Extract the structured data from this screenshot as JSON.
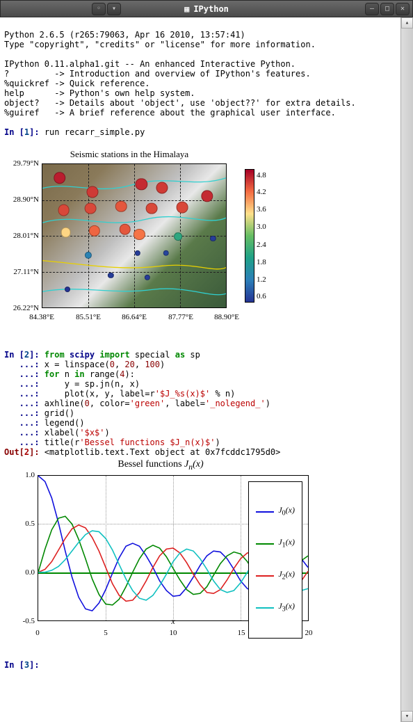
{
  "window": {
    "title": "IPython"
  },
  "intro": {
    "l1": "Python 2.6.5 (r265:79063, Apr 16 2010, 13:57:41)",
    "l2": "Type \"copyright\", \"credits\" or \"license\" for more information.",
    "l3": "IPython 0.11.alpha1.git -- An enhanced Interactive Python.",
    "l4": "?         -> Introduction and overview of IPython's features.",
    "l5": "%quickref -> Quick reference.",
    "l6": "help      -> Python's own help system.",
    "l7": "object?   -> Details about 'object', use 'object??' for extra details.",
    "l8": "%guiref   -> A brief reference about the graphical user interface."
  },
  "prompts": {
    "in": "In [",
    "close": "]: ",
    "cont": "   ...: ",
    "out": "Out[",
    "n1": "1",
    "n2": "2",
    "n3": "3"
  },
  "cell1": {
    "code": "run recarr_simple.py"
  },
  "cell2": {
    "kw_from": "from",
    "mod": "scipy",
    "kw_import": "import",
    "sub": "special",
    "kw_as": "as",
    "alias": "sp",
    "l2a": "x = linspace(",
    "l2b": "0",
    "l2c": ", ",
    "l2d": "20",
    "l2e": ", ",
    "l2f": "100",
    "l2g": ")",
    "kw_for": "for",
    "l3a": " n ",
    "kw_in": "in",
    "l3b": " range(",
    "l3c": "4",
    "l3d": "):",
    "l4": "    y = sp.jn(n, x)",
    "l5a": "    plot(x, y, label=r",
    "l5b": "'$J_%s(x)$'",
    "l5c": " % n)",
    "l6a": "axhline(",
    "l6b": "0",
    "l6c": ", color=",
    "l6d": "'green'",
    "l6e": ", label=",
    "l6f": "'_nolegend_'",
    "l6g": ")",
    "l7": "grid()",
    "l8": "legend()",
    "l9a": "xlabel(",
    "l9b": "'$x$'",
    "l9c": ")",
    "l10a": "title(r",
    "l10b": "'Bessel functions $J_n(x)$'",
    "l10c": ")",
    "out": "<matplotlib.text.Text object at 0x7fcddc1795d0>"
  },
  "chart_data": [
    {
      "type": "scatter",
      "title": "Seismic stations in the Himalaya",
      "xlabel": "",
      "ylabel": "",
      "xticks": [
        "84.38°E",
        "85.51°E",
        "86.64°E",
        "87.77°E",
        "88.90°E"
      ],
      "yticks": [
        "26.22°N",
        "27.11°N",
        "28.01°N",
        "28.90°N",
        "29.79°N"
      ],
      "xlim": [
        84.38,
        88.9
      ],
      "ylim": [
        26.22,
        29.79
      ],
      "colorbar_ticks": [
        "4.8",
        "4.2",
        "3.6",
        "3.0",
        "2.4",
        "1.8",
        "1.2",
        "0.6"
      ],
      "points": [
        {
          "lon": 84.8,
          "lat": 29.45,
          "v": 4.6
        },
        {
          "lon": 85.6,
          "lat": 29.1,
          "v": 4.4
        },
        {
          "lon": 86.8,
          "lat": 29.3,
          "v": 4.5
        },
        {
          "lon": 87.3,
          "lat": 29.2,
          "v": 4.4
        },
        {
          "lon": 88.4,
          "lat": 29.0,
          "v": 4.5
        },
        {
          "lon": 84.9,
          "lat": 28.65,
          "v": 4.3
        },
        {
          "lon": 85.55,
          "lat": 28.7,
          "v": 4.3
        },
        {
          "lon": 86.3,
          "lat": 28.75,
          "v": 4.2
        },
        {
          "lon": 87.05,
          "lat": 28.7,
          "v": 4.3
        },
        {
          "lon": 87.8,
          "lat": 28.73,
          "v": 4.3
        },
        {
          "lon": 84.95,
          "lat": 28.1,
          "v": 3.4
        },
        {
          "lon": 85.65,
          "lat": 28.15,
          "v": 4.1
        },
        {
          "lon": 86.4,
          "lat": 28.18,
          "v": 4.2
        },
        {
          "lon": 86.75,
          "lat": 28.05,
          "v": 4.0
        },
        {
          "lon": 87.7,
          "lat": 28.0,
          "v": 2.2
        },
        {
          "lon": 88.55,
          "lat": 27.95,
          "v": 0.7
        },
        {
          "lon": 85.5,
          "lat": 27.55,
          "v": 1.5
        },
        {
          "lon": 86.7,
          "lat": 27.6,
          "v": 0.7
        },
        {
          "lon": 87.4,
          "lat": 27.6,
          "v": 0.8
        },
        {
          "lon": 86.05,
          "lat": 27.05,
          "v": 0.7
        },
        {
          "lon": 86.95,
          "lat": 27.0,
          "v": 0.7
        },
        {
          "lon": 85.0,
          "lat": 26.7,
          "v": 0.6
        }
      ],
      "color_range": [
        0.6,
        4.8
      ]
    },
    {
      "type": "line",
      "title_prefix": "Bessel functions ",
      "title_math_j": "J",
      "title_math_sub": "n",
      "title_math_x": "(x)",
      "xlabel": "x",
      "ylabel": "",
      "xticks": [
        "0",
        "5",
        "10",
        "15",
        "20"
      ],
      "yticks": [
        "-0.5",
        "0.0",
        "0.5",
        "1.0"
      ],
      "xlim": [
        0,
        20
      ],
      "ylim": [
        -0.5,
        1.0
      ],
      "legend": [
        "J₀(x)",
        "J₁(x)",
        "J₂(x)",
        "J₃(x)"
      ],
      "legend_prefix": "J",
      "legend_sub": [
        "0",
        "1",
        "2",
        "3"
      ],
      "legend_suffix": "(x)",
      "colors": [
        "#1010dd",
        "#008800",
        "#dd2020",
        "#10c0c0"
      ],
      "series": [
        {
          "name": "J0",
          "values": [
            1.0,
            0.94,
            0.77,
            0.51,
            0.22,
            -0.05,
            -0.26,
            -0.38,
            -0.4,
            -0.32,
            -0.18,
            -0.01,
            0.15,
            0.27,
            0.3,
            0.27,
            0.17,
            0.05,
            -0.09,
            -0.19,
            -0.25,
            -0.24,
            -0.16,
            -0.05,
            0.07,
            0.17,
            0.22,
            0.21,
            0.14,
            0.03,
            -0.09,
            -0.17,
            -0.2,
            -0.18,
            -0.1,
            0.01,
            0.11,
            0.18,
            0.19,
            0.14,
            0.05
          ]
        },
        {
          "name": "J1",
          "values": [
            0.0,
            0.24,
            0.44,
            0.56,
            0.58,
            0.5,
            0.34,
            0.14,
            -0.07,
            -0.23,
            -0.33,
            -0.34,
            -0.28,
            -0.15,
            0.0,
            0.14,
            0.24,
            0.28,
            0.25,
            0.16,
            0.04,
            -0.08,
            -0.18,
            -0.23,
            -0.22,
            -0.15,
            -0.03,
            0.09,
            0.17,
            0.21,
            0.19,
            0.11,
            0.0,
            -0.1,
            -0.17,
            -0.19,
            -0.16,
            -0.08,
            0.02,
            0.12,
            0.17
          ]
        },
        {
          "name": "J2",
          "values": [
            0.0,
            0.03,
            0.11,
            0.23,
            0.35,
            0.45,
            0.49,
            0.46,
            0.36,
            0.22,
            0.05,
            -0.12,
            -0.24,
            -0.3,
            -0.29,
            -0.21,
            -0.09,
            0.05,
            0.17,
            0.24,
            0.25,
            0.2,
            0.1,
            -0.02,
            -0.13,
            -0.21,
            -0.22,
            -0.18,
            -0.08,
            0.04,
            0.14,
            0.2,
            0.2,
            0.14,
            0.04,
            -0.07,
            -0.16,
            -0.19,
            -0.17,
            -0.09,
            0.01
          ]
        },
        {
          "name": "J3",
          "values": [
            0.0,
            0.0,
            0.02,
            0.06,
            0.13,
            0.22,
            0.31,
            0.39,
            0.43,
            0.42,
            0.35,
            0.23,
            0.08,
            -0.07,
            -0.19,
            -0.27,
            -0.29,
            -0.24,
            -0.14,
            -0.02,
            0.11,
            0.2,
            0.24,
            0.22,
            0.14,
            0.03,
            -0.09,
            -0.18,
            -0.21,
            -0.19,
            -0.11,
            0.0,
            0.11,
            0.18,
            0.19,
            0.15,
            0.06,
            -0.05,
            -0.14,
            -0.19,
            -0.17
          ]
        }
      ]
    }
  ]
}
